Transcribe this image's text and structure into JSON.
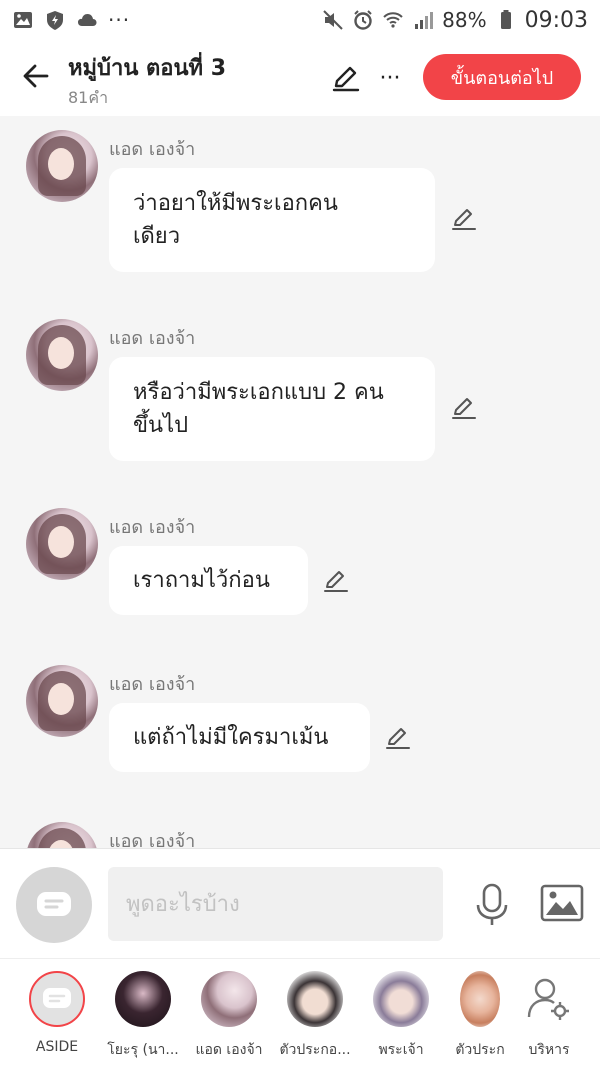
{
  "status_bar": {
    "battery": "88%",
    "time": "09:03",
    "overflow": "···"
  },
  "header": {
    "title": "หมู่บ้าน ตอนที่ 3",
    "word_count": "81คำ",
    "next_label": "ขั้นตอนต่อไป",
    "more": "···"
  },
  "messages": [
    {
      "name": "แอด เองจ้า",
      "text": "ว่าอยาให้มีพระเอกคน\nเดียว"
    },
    {
      "name": "แอด เองจ้า",
      "text": "หรือว่ามีพระเอกแบบ 2 คน\nขึ้นไป"
    },
    {
      "name": "แอด เองจ้า",
      "text": "เราถามไว้ก่อน"
    },
    {
      "name": "แอด เองจ้า",
      "text": "แต่ถ้าไม่มีใครมาเม้น"
    },
    {
      "name": "แอด เองจ้า",
      "text": ""
    }
  ],
  "input": {
    "placeholder": "พูดอะไรบ้าง"
  },
  "characters": [
    {
      "label": "ASIDE"
    },
    {
      "label": "โยะรุ (นา..."
    },
    {
      "label": "แอด เองจ้า"
    },
    {
      "label": "ตัวประกอ..."
    },
    {
      "label": "พระเจ้า"
    },
    {
      "label": "ตัวประก"
    },
    {
      "label": "บริหาร"
    }
  ],
  "colors": {
    "accent": "#f24448",
    "background": "#f5f5f5",
    "bubble": "#ffffff"
  }
}
